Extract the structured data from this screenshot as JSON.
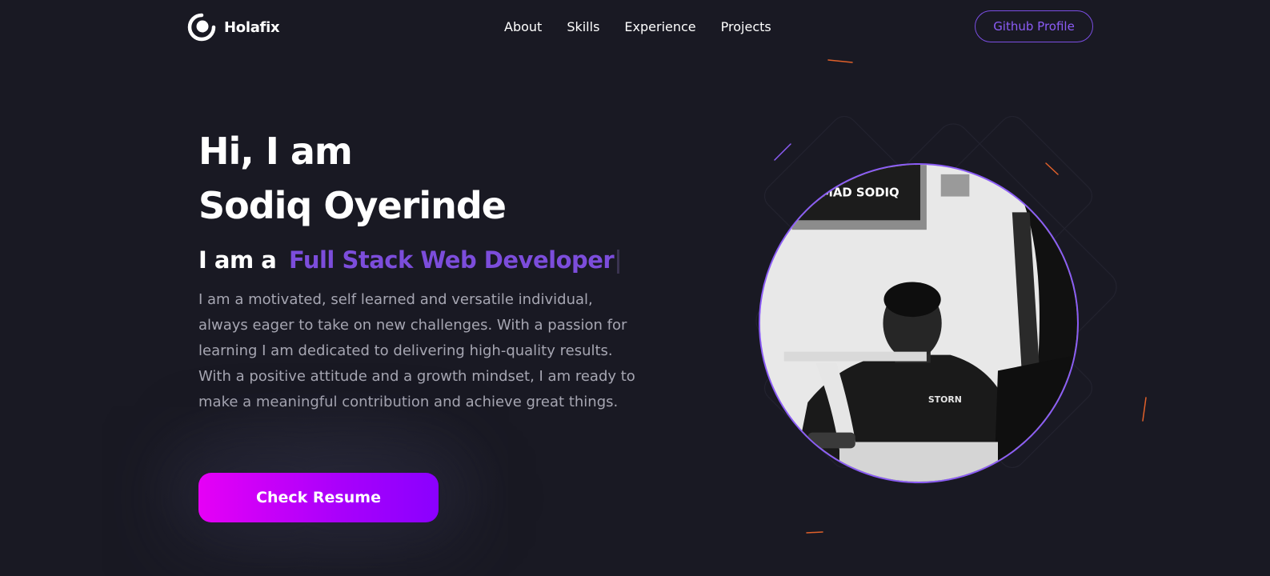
{
  "brand": {
    "name": "Holafix"
  },
  "nav": {
    "items": [
      {
        "label": "About"
      },
      {
        "label": "Skills"
      },
      {
        "label": "Experience"
      },
      {
        "label": "Projects"
      }
    ]
  },
  "header": {
    "github_label": "Github Profile"
  },
  "hero": {
    "greeting": "Hi, I am",
    "name": "Sodiq Oyerinde",
    "role_prefix": "I am a",
    "role_title": "Full Stack Web Developer",
    "bio": "I am a motivated, self learned and versatile individual, always eager to take on new challenges. With a passion for learning I am dedicated to delivering high-quality results. With a positive attitude and a growth mindset, I am ready to make a meaningful contribution and achieve great things.",
    "cta_label": "Check Resume"
  },
  "portrait": {
    "sign_text": "MMAD SODIQ",
    "shirt_text": "STORN"
  },
  "colors": {
    "background": "#191923",
    "accent": "#8b5cf6",
    "accent_text": "#7c4ddb",
    "button_gradient_start": "#e600f6",
    "button_gradient_end": "#8a00ff",
    "body_text": "#a6a6b2",
    "spark": "#e0602a"
  },
  "icons": {
    "logo": "ring-logo-icon"
  }
}
